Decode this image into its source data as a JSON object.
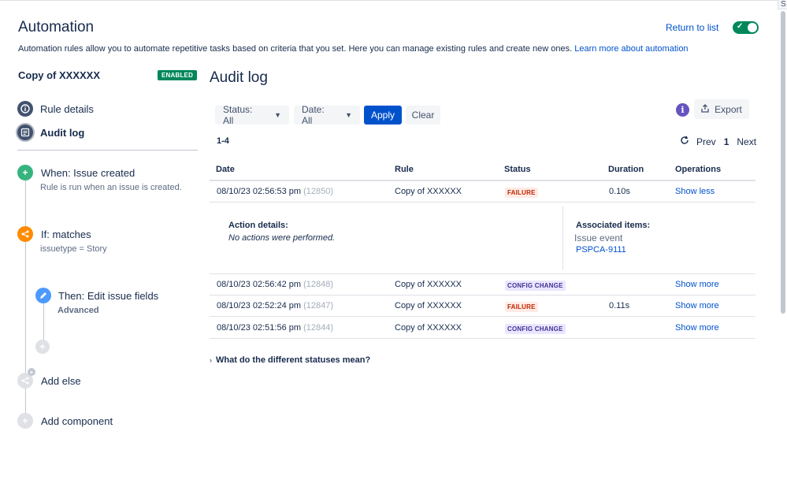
{
  "header": {
    "title": "Automation",
    "return_link": "Return to list",
    "description": "Automation rules allow you to automate repetitive tasks based on criteria that you set. Here you can manage existing rules and create new ones.",
    "learn_more": "Learn more about automation",
    "toggle_enabled": true,
    "corner_label": "S"
  },
  "sidebar": {
    "rule_name": "Copy of XXXXXX",
    "status_badge": "ENABLED",
    "nav": [
      {
        "label": "Rule details",
        "icon": "info-icon"
      },
      {
        "label": "Audit log",
        "icon": "list-icon",
        "active": true
      }
    ],
    "components": [
      {
        "title": "When: Issue created",
        "subtitle": "Rule is run when an issue is created.",
        "icon": "plus-icon",
        "color": "#36b37e"
      },
      {
        "title": "If: matches",
        "subtitle": "issuetype = Story",
        "icon": "branch-icon",
        "color": "#ff8b00"
      },
      {
        "title": "Then: Edit issue fields",
        "subtitle": "Advanced",
        "icon": "pencil-icon",
        "color": "#4c9aff"
      }
    ],
    "add_else": "Add else",
    "add_component": "Add component"
  },
  "main": {
    "title": "Audit log",
    "filters": {
      "status": "Status: All",
      "date": "Date: All",
      "apply": "Apply",
      "clear": "Clear",
      "export": "Export"
    },
    "range": "1-4",
    "pager": {
      "prev": "Prev",
      "page": "1",
      "next": "Next"
    },
    "columns": [
      "Date",
      "Rule",
      "Status",
      "Duration",
      "Operations"
    ],
    "rows": [
      {
        "date": "08/10/23 02:56:53 pm",
        "id": "(12850)",
        "rule": "Copy of XXXXXX",
        "status": "FAILURE",
        "duration": "0.10s",
        "op": "Show less"
      },
      {
        "date": "08/10/23 02:56:42 pm",
        "id": "(12848)",
        "rule": "Copy of XXXXXX",
        "status": "CONFIG CHANGE",
        "duration": "",
        "op": "Show more"
      },
      {
        "date": "08/10/23 02:52:24 pm",
        "id": "(12847)",
        "rule": "Copy of XXXXXX",
        "status": "FAILURE",
        "duration": "0.11s",
        "op": "Show more"
      },
      {
        "date": "08/10/23 02:51:56 pm",
        "id": "(12844)",
        "rule": "Copy of XXXXXX",
        "status": "CONFIG CHANGE",
        "duration": "",
        "op": "Show more"
      }
    ],
    "details": {
      "action_label": "Action details:",
      "action_value": "No actions were performed.",
      "assoc_label": "Associated items:",
      "assoc_type": "Issue event",
      "assoc_link": "PSPCA-9111"
    },
    "faq": "What do the different statuses mean?"
  },
  "colors": {
    "brand": "#0052cc",
    "enabled": "#00875a",
    "failure_bg": "#ffebe6",
    "failure_fg": "#bf2600",
    "config_bg": "#eae6ff",
    "config_fg": "#403294"
  }
}
